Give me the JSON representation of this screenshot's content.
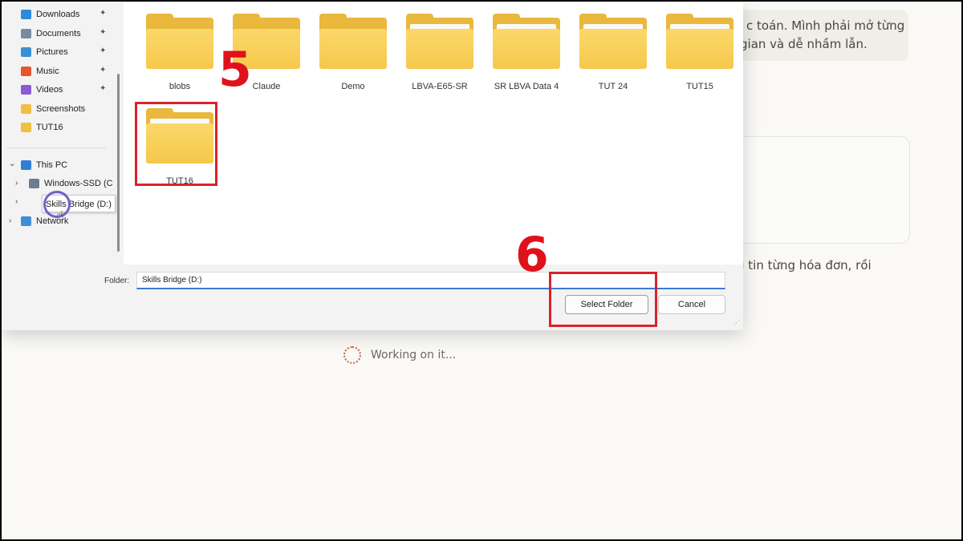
{
  "chat": {
    "bubble_line1": "c toán. Mình phải mở từng",
    "bubble_line2": "gian và dễ nhầm lẫn.",
    "reply_text": "g tin từng hóa đơn, rồi",
    "status_text": "Working on it..."
  },
  "nav": {
    "quick_access": [
      {
        "label": "Downloads",
        "icon": "download-icon",
        "color": "#2e8bd9"
      },
      {
        "label": "Documents",
        "icon": "documents-icon",
        "color": "#7a8aa3"
      },
      {
        "label": "Pictures",
        "icon": "pictures-icon",
        "color": "#3a8fd6"
      },
      {
        "label": "Music",
        "icon": "music-icon",
        "color": "#e4572e"
      },
      {
        "label": "Videos",
        "icon": "videos-icon",
        "color": "#8a5bd6"
      },
      {
        "label": "Screenshots",
        "icon": "folder-icon",
        "color": "#f0bf43"
      },
      {
        "label": "TUT16",
        "icon": "folder-icon",
        "color": "#f0bf43"
      }
    ],
    "this_pc": "This PC",
    "drive_c": "Windows-SSD (C",
    "drive_d_tooltip": "Skills Bridge (D:)",
    "network": "Network"
  },
  "folders": [
    {
      "label": "blobs",
      "preview": "plain"
    },
    {
      "label": "Claude",
      "preview": "plain"
    },
    {
      "label": "Demo",
      "preview": "plain"
    },
    {
      "label": "LBVA-E65-SR",
      "preview": "image"
    },
    {
      "label": "SR LBVA Data 4",
      "preview": "photo"
    },
    {
      "label": "TUT 24",
      "preview": "document"
    },
    {
      "label": "TUT15",
      "preview": "photo"
    },
    {
      "label": "TUT16",
      "preview": "document"
    }
  ],
  "annotations": {
    "step5": "5",
    "step6": "6"
  },
  "bottom": {
    "folder_label": "Folder:",
    "folder_value": "Skills Bridge (D:)",
    "select_label": "Select Folder",
    "cancel_label": "Cancel"
  },
  "colors": {
    "accent_red": "#e0111b",
    "folder_yellow": "#f6c84c"
  }
}
